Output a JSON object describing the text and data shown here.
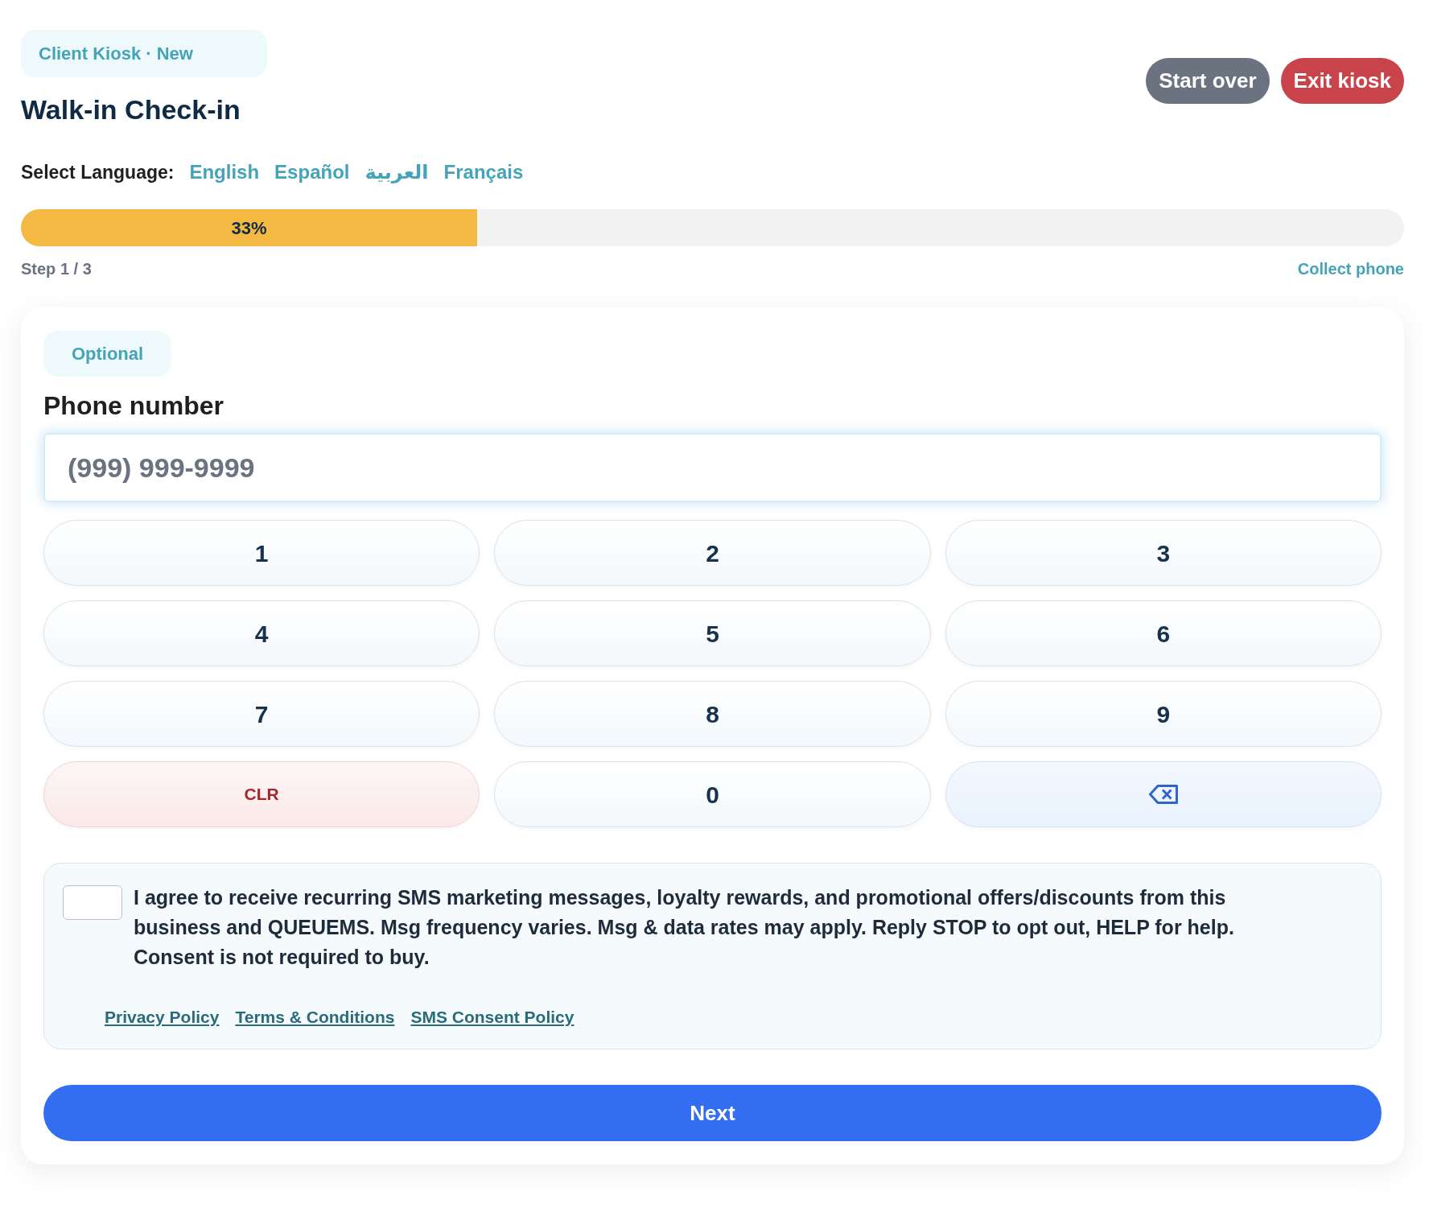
{
  "header": {
    "badge": "Client Kiosk · New",
    "title": "Walk-in Check-in",
    "buttons": [
      {
        "kind": "secondary",
        "label": "Start over"
      },
      {
        "kind": "danger",
        "label": "Exit kiosk"
      }
    ]
  },
  "language": {
    "label": "Select Language:",
    "options": [
      "English",
      "Español",
      "العربية",
      "Français"
    ]
  },
  "progress": {
    "level": 0.33,
    "label": "33%",
    "step": "Step 1 / 3",
    "step_name": "Collect phone"
  },
  "form": {
    "badge": "Optional",
    "field_label": "Phone number",
    "phone_field": {
      "placeholder": "(999) 999-9999"
    },
    "keypad": [
      {
        "kind": "digit",
        "label": "1"
      },
      {
        "kind": "digit",
        "label": "2"
      },
      {
        "kind": "digit",
        "label": "3"
      },
      {
        "kind": "digit",
        "label": "4"
      },
      {
        "kind": "digit",
        "label": "5"
      },
      {
        "kind": "digit",
        "label": "6"
      },
      {
        "kind": "digit",
        "label": "7"
      },
      {
        "kind": "digit",
        "label": "8"
      },
      {
        "kind": "digit",
        "label": "9"
      },
      {
        "kind": "clear",
        "label": "CLR"
      },
      {
        "kind": "digit",
        "label": "0"
      },
      {
        "kind": "backspace"
      }
    ],
    "consent": {
      "checked": false,
      "text": "I agree to receive recurring SMS marketing messages, loyalty rewards, and promotional offers/discounts from this business and QUEUEMS. Msg frequency varies. Msg & data rates may apply. Reply STOP to opt out, HELP for help. Consent is not required to buy.",
      "links": [
        "Privacy Policy",
        "Terms & Conditions",
        "SMS Consent Policy"
      ]
    },
    "submit": "Next"
  }
}
